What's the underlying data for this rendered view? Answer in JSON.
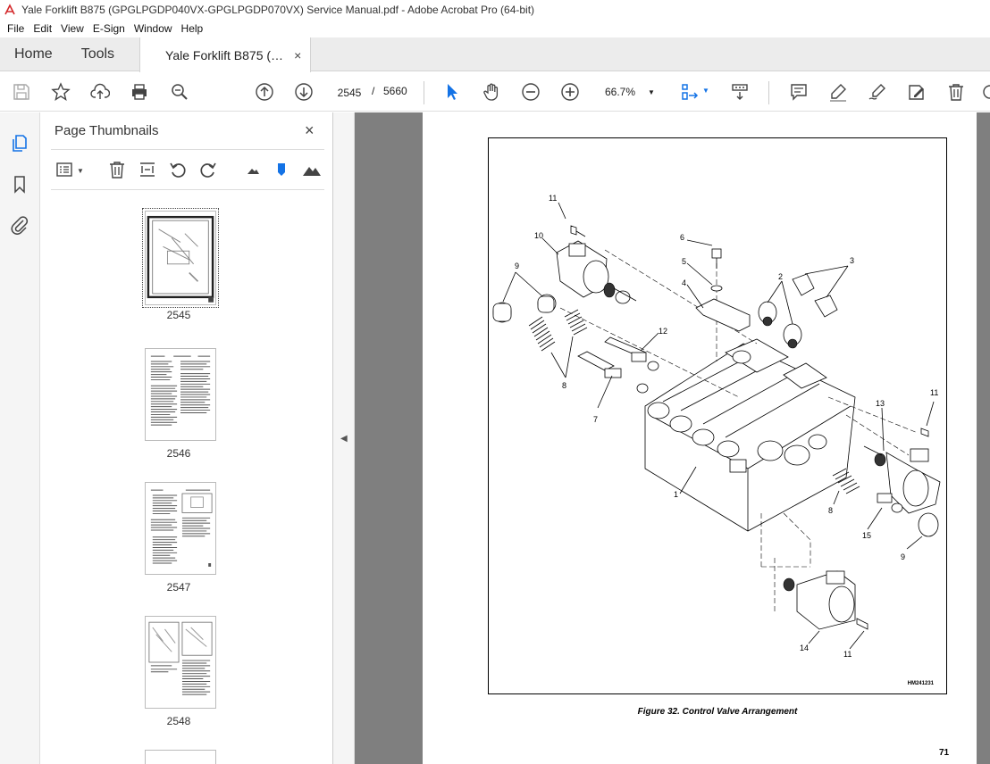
{
  "window": {
    "title": "Yale Forklift B875 (GPGLPGDP040VX-GPGLPGDP070VX) Service Manual.pdf - Adobe Acrobat Pro (64-bit)"
  },
  "menu": [
    "File",
    "Edit",
    "View",
    "E-Sign",
    "Window",
    "Help"
  ],
  "tabs": {
    "home": "Home",
    "tools": "Tools",
    "document": "Yale Forklift B875 (…",
    "close": "×"
  },
  "toolbar": {
    "current_page": "2545",
    "page_separator": "/",
    "total_pages": "5660",
    "zoom": "66.7%"
  },
  "panel": {
    "title": "Page Thumbnails",
    "thumbnails": [
      {
        "label": "2545",
        "selected": true
      },
      {
        "label": "2546",
        "selected": false
      },
      {
        "label": "2547",
        "selected": false
      },
      {
        "label": "2548",
        "selected": false
      }
    ]
  },
  "document": {
    "callouts": [
      "11",
      "10",
      "9",
      "6",
      "5",
      "4",
      "3",
      "2",
      "12",
      "8",
      "7",
      "11",
      "13",
      "1",
      "8",
      "15",
      "9",
      "14",
      "11"
    ],
    "figure_code": "HM241231",
    "caption": "Figure 32. Control Valve Arrangement",
    "page_number": "71"
  },
  "colors": {
    "accent_blue": "#1473e6",
    "doc_background": "#7f7f7f",
    "acrobat_red": "#d4282b"
  }
}
